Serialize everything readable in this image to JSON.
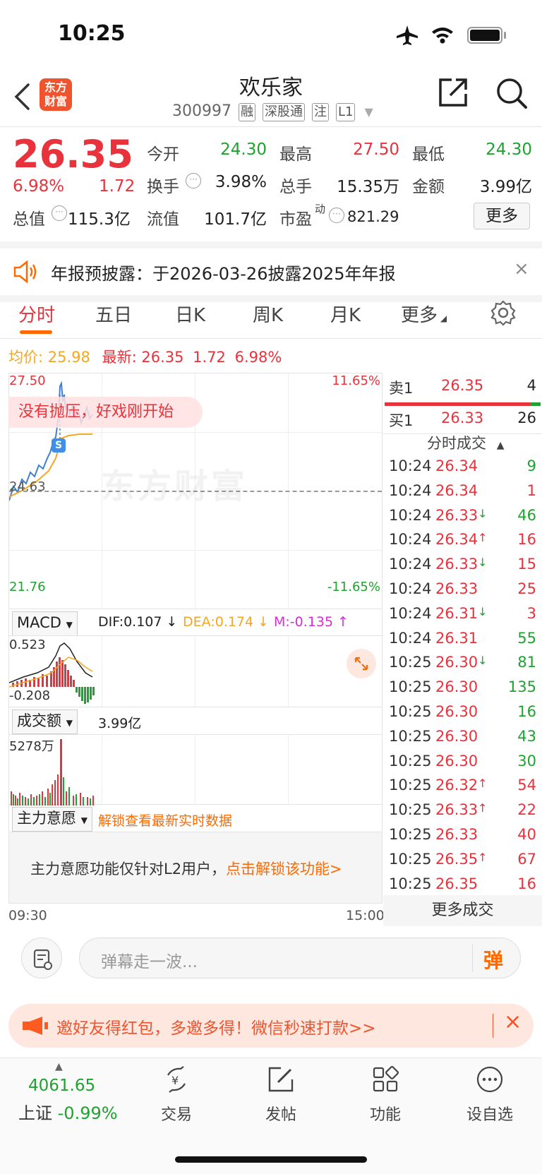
{
  "status": {
    "time": "10:25"
  },
  "header": {
    "logo_line1": "东方",
    "logo_line2": "财富",
    "stock_name": "欢乐家",
    "stock_code": "300997",
    "tags": [
      "融",
      "深股通",
      "注",
      "L1"
    ]
  },
  "quote": {
    "price": "26.35",
    "change_pct": "6.98%",
    "change": "1.72",
    "open_label": "今开",
    "open": "24.30",
    "high_label": "最高",
    "high": "27.50",
    "low_label": "最低",
    "low": "24.30",
    "turnover_label": "换手",
    "turnover": "3.98%",
    "volume_label": "总手",
    "volume": "15.35万",
    "amount_label": "金额",
    "amount": "3.99亿",
    "mktcap_label": "总值",
    "mktcap": "115.3亿",
    "float_label": "流值",
    "float": "101.7亿",
    "pe_label": "市盈",
    "pe_sup": "动",
    "pe": "821.29",
    "more_label": "更多"
  },
  "notice": {
    "text": "年报预披露：于2026-03-26披露2025年年报"
  },
  "tabs": [
    "分时",
    "五日",
    "日K",
    "周K",
    "月K",
    "更多"
  ],
  "summary": {
    "avg_label": "均价:",
    "avg": "25.98",
    "latest_label": "最新:",
    "latest": "26.35",
    "chg": "1.72",
    "pct": "6.98%"
  },
  "chart": {
    "y_top": "27.50",
    "y_mid": "24.63",
    "y_bottom": "21.76",
    "pct_top": "11.65%",
    "pct_bottom": "-11.65%",
    "tip": "没有抛压，好戏刚开始",
    "watermark": "东方财富",
    "marker": "S",
    "x_start": "09:30",
    "x_end": "15:00"
  },
  "macd": {
    "label": "MACD",
    "dif": "DIF:0.107 ↓",
    "dea": "DEA:0.174 ↓",
    "m": "M:-0.135 ↑",
    "top": "0.523",
    "bottom": "-0.208"
  },
  "volume_panel": {
    "label": "成交额",
    "value": "3.99亿",
    "top": "5278万"
  },
  "capital": {
    "label": "主力意愿",
    "unlock": "解锁查看最新实时数据",
    "info": "主力意愿功能仅针对L2用户，",
    "link": "点击解锁该功能>"
  },
  "order_book": {
    "sell_label": "卖1",
    "sell_price": "26.35",
    "sell_vol": "4",
    "buy_label": "买1",
    "buy_price": "26.33",
    "buy_vol": "26",
    "ticks_title": "分时成交",
    "more": "更多成交"
  },
  "ticks": [
    {
      "t": "10:24",
      "p": "26.34",
      "d": "",
      "v": "9",
      "c": "green"
    },
    {
      "t": "10:24",
      "p": "26.34",
      "d": "",
      "v": "1",
      "c": "red"
    },
    {
      "t": "10:24",
      "p": "26.33",
      "d": "↓",
      "v": "46",
      "c": "green"
    },
    {
      "t": "10:24",
      "p": "26.34",
      "d": "↑",
      "v": "16",
      "c": "red"
    },
    {
      "t": "10:24",
      "p": "26.33",
      "d": "↓",
      "v": "15",
      "c": "red"
    },
    {
      "t": "10:24",
      "p": "26.33",
      "d": "",
      "v": "25",
      "c": "red"
    },
    {
      "t": "10:24",
      "p": "26.31",
      "d": "↓",
      "v": "3",
      "c": "red"
    },
    {
      "t": "10:24",
      "p": "26.31",
      "d": "",
      "v": "55",
      "c": "green"
    },
    {
      "t": "10:25",
      "p": "26.30",
      "d": "↓",
      "v": "81",
      "c": "green"
    },
    {
      "t": "10:25",
      "p": "26.30",
      "d": "",
      "v": "135",
      "c": "green"
    },
    {
      "t": "10:25",
      "p": "26.30",
      "d": "",
      "v": "16",
      "c": "green"
    },
    {
      "t": "10:25",
      "p": "26.30",
      "d": "",
      "v": "43",
      "c": "green"
    },
    {
      "t": "10:25",
      "p": "26.30",
      "d": "",
      "v": "30",
      "c": "green"
    },
    {
      "t": "10:25",
      "p": "26.32",
      "d": "↑",
      "v": "54",
      "c": "red"
    },
    {
      "t": "10:25",
      "p": "26.33",
      "d": "↑",
      "v": "22",
      "c": "red"
    },
    {
      "t": "10:25",
      "p": "26.33",
      "d": "",
      "v": "40",
      "c": "red"
    },
    {
      "t": "10:25",
      "p": "26.35",
      "d": "↑",
      "v": "67",
      "c": "red"
    },
    {
      "t": "10:25",
      "p": "26.35",
      "d": "",
      "v": "16",
      "c": "red"
    }
  ],
  "comment": {
    "placeholder": "弹幕走一波...",
    "danmu": "弹"
  },
  "promo": {
    "text": "邀好友得红包，多邀多得！微信秒速打款>>"
  },
  "bottom_nav": {
    "index_value": "4061.65",
    "index_name": "上证",
    "index_change": "-0.99%",
    "items": [
      "交易",
      "发帖",
      "功能",
      "设自选"
    ]
  },
  "colors": {
    "red": "#e8323c",
    "green": "#1fa22f",
    "orange": "#ff6a00",
    "avg_line": "#f5a623",
    "price_line": "#3f7fd4"
  }
}
